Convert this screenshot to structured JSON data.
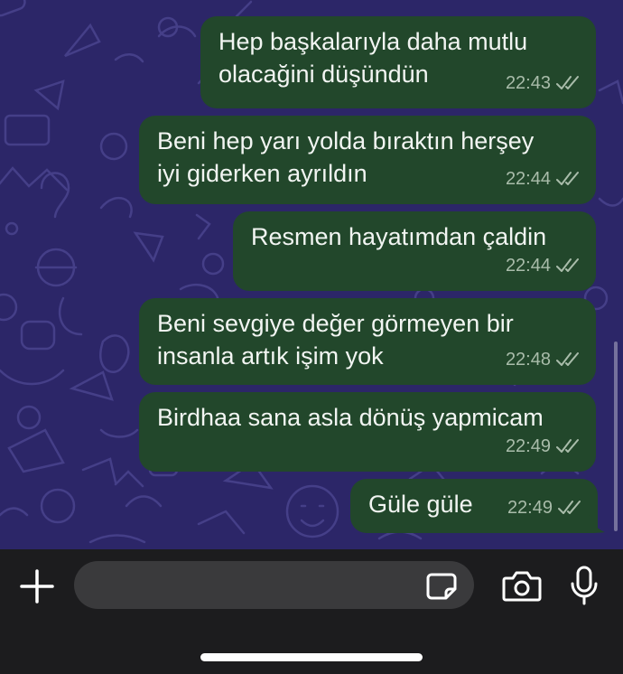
{
  "messages": [
    {
      "text": "Hep başkalarıyla daha mutlu olacağini düşündün",
      "line1": "Hep başkalarıyla daha mutlu",
      "line2": "olacağini düşündün",
      "time": "22:43"
    },
    {
      "text": "Beni hep yarı yolda bıraktın herşey iyi giderken ayrıldın",
      "line1": "Beni hep yarı yolda bıraktın herşey",
      "line2": "iyi giderken ayrıldın",
      "time": "22:44"
    },
    {
      "text": "Resmen hayatımdan  çaldin",
      "line1": "Resmen hayatımdan  çaldin",
      "time": "22:44"
    },
    {
      "text": "Beni sevgiye değer görmeyen bir insanla artık işim yok",
      "line1": "Beni sevgiye değer görmeyen bir",
      "line2": "insanla artık işim yok",
      "time": "22:48"
    },
    {
      "text": "Birdhaa sana asla dönüş yapmicam",
      "line1": "Birdhaa sana asla dönüş yapmicam",
      "time": "22:49"
    },
    {
      "text": "Güle güle",
      "line1": "Güle güle",
      "time": "22:49"
    }
  ],
  "colors": {
    "chat_background": "#2c2668",
    "outgoing_bubble": "#22472b",
    "input_bar": "#1c1c1e",
    "input_field": "#3a3a3c"
  },
  "icons": {
    "attach": "plus-icon",
    "sticker": "sticker-icon",
    "camera": "camera-icon",
    "microphone": "microphone-icon",
    "read_receipt": "double-check-icon"
  }
}
